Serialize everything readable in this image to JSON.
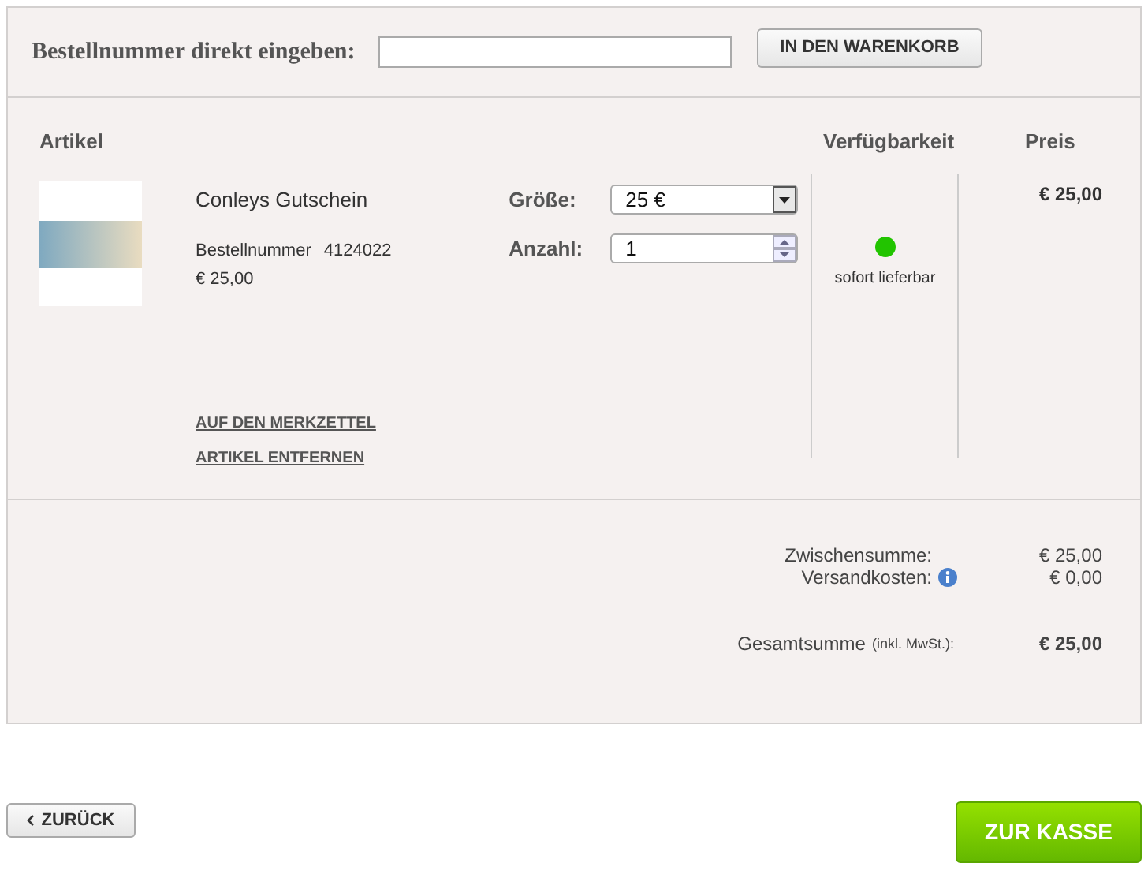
{
  "quick_order": {
    "label": "Bestellnummer direkt eingeben:",
    "button": "IN DEN WARENKORB"
  },
  "columns": {
    "article": "Artikel",
    "availability": "Verfügbarkeit",
    "price": "Preis"
  },
  "items": [
    {
      "name": "Conleys Gutschein",
      "order_number_label": "Bestellnummer",
      "order_number": "4124022",
      "unit_price": "€ 25,00",
      "size_label": "Größe:",
      "size": "25 €",
      "quantity_label": "Anzahl:",
      "quantity": "1",
      "availability": {
        "label": "sofort lieferbar",
        "color": "#22c400"
      },
      "price": "€ 25,00",
      "links": [
        "AUF DEN MERKZETTEL",
        "ARTIKEL ENTFERNEN"
      ]
    }
  ],
  "totals": {
    "subtotal_label": "Zwischensumme:",
    "subtotal": "€ 25,00",
    "shipping_label": "Versandkosten:",
    "shipping": "€ 0,00",
    "total_label": "Gesamtsumme",
    "total_note": "(inkl. MwSt.):",
    "total": "€ 25,00"
  },
  "back_button": "ZURÜCK",
  "checkout_button": "ZUR KASSE"
}
